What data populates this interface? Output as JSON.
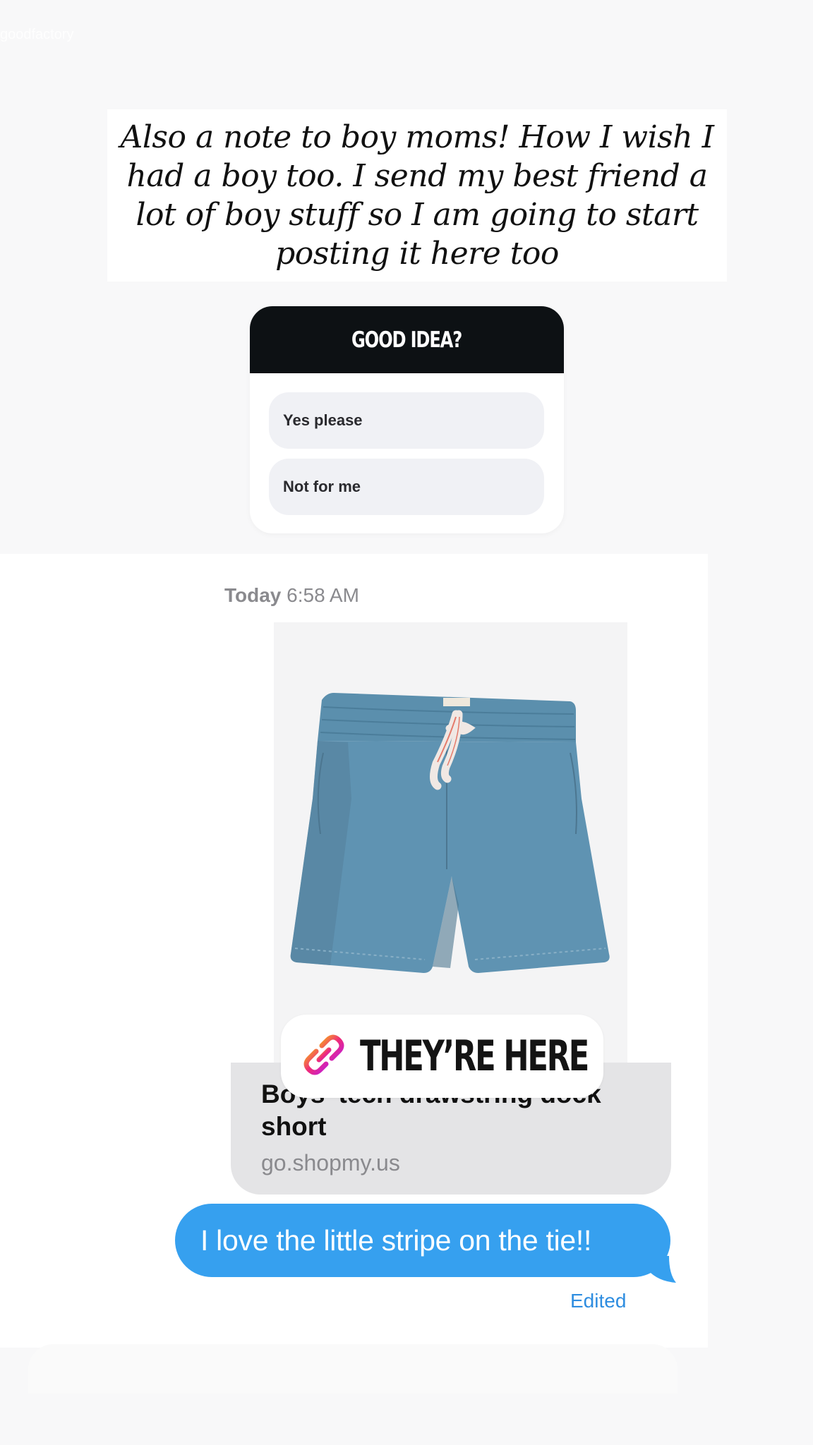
{
  "watermark": "goodfactory",
  "caption": "Also a note to boy moms! How I wish I had a boy too. I send my best friend a lot of boy stuff so I am going to start posting it here too",
  "poll": {
    "question": "GOOD IDEA?",
    "options": [
      "Yes please",
      "Not for me"
    ]
  },
  "message_thread": {
    "timestamp_day": "Today",
    "timestamp_time": "6:58 AM",
    "link_preview": {
      "title": "Boys' tech drawstring dock short",
      "domain": "go.shopmy.us"
    },
    "link_sticker": {
      "label": "THEY’RE HERE",
      "icon": "link-icon"
    },
    "outgoing_message": "I love the little stripe on the tie!!",
    "status": "Edited"
  },
  "colors": {
    "bubble_blue": "#36a0ef",
    "poll_header": "#0d1114",
    "shorts_blue": "#5b8fad",
    "link_gradient_start": "#f7a91c",
    "link_gradient_end": "#c21fd8"
  }
}
